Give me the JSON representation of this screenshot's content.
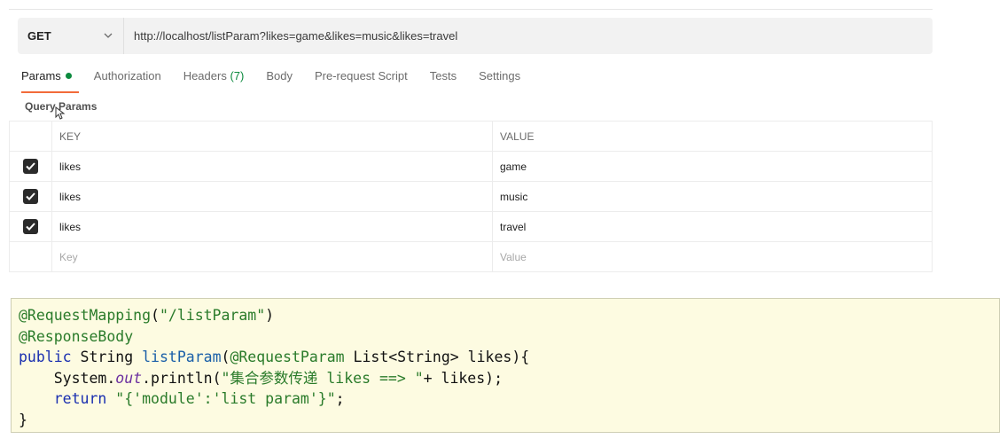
{
  "request": {
    "method": "GET",
    "url": "http://localhost/listParam?likes=game&likes=music&likes=travel"
  },
  "tabs": [
    {
      "label": "Params"
    },
    {
      "label": "Authorization"
    },
    {
      "label": "Headers",
      "count": "(7)"
    },
    {
      "label": "Body"
    },
    {
      "label": "Pre-request Script"
    },
    {
      "label": "Tests"
    },
    {
      "label": "Settings"
    }
  ],
  "query_params": {
    "title": "Query Params",
    "headers": {
      "key": "KEY",
      "value": "VALUE"
    },
    "rows": [
      {
        "key": "likes",
        "value": "game",
        "checked": true
      },
      {
        "key": "likes",
        "value": "music",
        "checked": true
      },
      {
        "key": "likes",
        "value": "travel",
        "checked": true
      }
    ],
    "placeholder": {
      "key": "Key",
      "value": "Value"
    }
  },
  "code": {
    "line1_ann": "@RequestMapping",
    "line1_paren_open": "(",
    "line1_str": "\"/listParam\"",
    "line1_paren_close": ")",
    "line2_ann": "@ResponseBody",
    "line3_kw": "public",
    "line3_type": " String ",
    "line3_method": "listParam",
    "line3_paren": "(",
    "line3_ann": "@RequestParam",
    "line3_rest": " List<String> likes){",
    "line4_pre": "    System.",
    "line4_field": "out",
    "line4_mid": ".println(",
    "line4_str": "\"集合参数传递 likes ==> \"",
    "line4_end": "+ likes);",
    "line5_indent": "    ",
    "line5_kw": "return",
    "line5_str": " \"{'module':'list param'}\"",
    "line5_end": ";",
    "line6": "}"
  }
}
